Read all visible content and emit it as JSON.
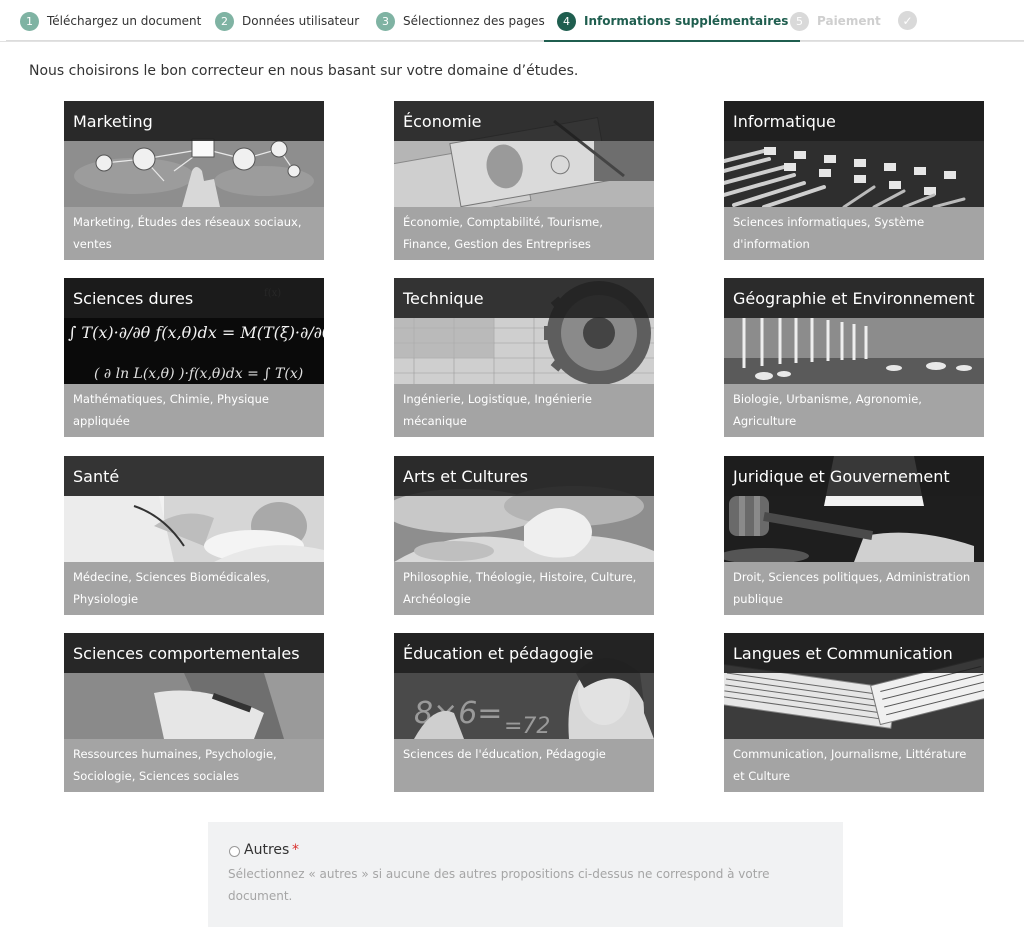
{
  "steps": [
    {
      "number": "1",
      "label": "Téléchargez un document",
      "state": "done"
    },
    {
      "number": "2",
      "label": "Données utilisateur",
      "state": "done"
    },
    {
      "number": "3",
      "label": "Sélectionnez des pages",
      "state": "done"
    },
    {
      "number": "4",
      "label": "Informations supplémentaires",
      "state": "active"
    },
    {
      "number": "5",
      "label": "Paiement",
      "state": "todo"
    }
  ],
  "final_step_icon": "check-icon",
  "intro": "Nous choisirons le bon correcteur en nous basant sur votre domaine d’études.",
  "fields": [
    {
      "title": "Marketing",
      "description": "Marketing, Études des réseaux sociaux, ventes",
      "image": "marketing-network-image"
    },
    {
      "title": "Économie",
      "description": "Économie, Comptabilité, Tourisme, Finance, Gestion des Entreprises",
      "image": "banknotes-image"
    },
    {
      "title": "Informatique",
      "description": "Sciences informatiques, Système d'information",
      "image": "network-switch-image"
    },
    {
      "title": "Sciences dures",
      "description": "Mathématiques, Chimie, Physique appliquée",
      "image": "formulas-chalkboard-image"
    },
    {
      "title": "Technique",
      "description": "Ingénierie, Logistique, Ingénierie mécanique",
      "image": "gear-blueprint-image"
    },
    {
      "title": "Géographie et Environnement",
      "description": "Biologie, Urbanisme, Agronomie, Agriculture",
      "image": "wind-turbines-image"
    },
    {
      "title": "Santé",
      "description": "Médecine, Sciences Biomédicales, Physiologie",
      "image": "doctor-baby-image"
    },
    {
      "title": "Arts et Cultures",
      "description": "Philosophie, Théologie, Histoire, Culture, Archéologie",
      "image": "classical-fresco-image"
    },
    {
      "title": "Juridique et Gouvernement",
      "description": "Droit, Sciences politiques, Administration publique",
      "image": "gavel-image"
    },
    {
      "title": "Sciences comportementales",
      "description": "Ressources humaines, Psychologie, Sociologie, Sciences sociales",
      "image": "therapy-session-image"
    },
    {
      "title": "Éducation et pédagogie",
      "description": "Sciences de l'éducation, Pédagogie",
      "image": "teacher-chalkboard-image"
    },
    {
      "title": "Langues et Communication",
      "description": "Communication, Journalisme, Littérature et Culture",
      "image": "newspapers-image"
    }
  ],
  "others": {
    "label": "Autres",
    "required_mark": "*",
    "help": "Sélectionnez « autres » si aucune des autres propositions ci-dessus ne correspond à votre document."
  },
  "colors": {
    "accent": "#1f5e4f",
    "step_done": "#7fb3a3",
    "step_todo": "#d9d9d9",
    "card_background": "#a4a4a4",
    "required": "#d9302c"
  }
}
